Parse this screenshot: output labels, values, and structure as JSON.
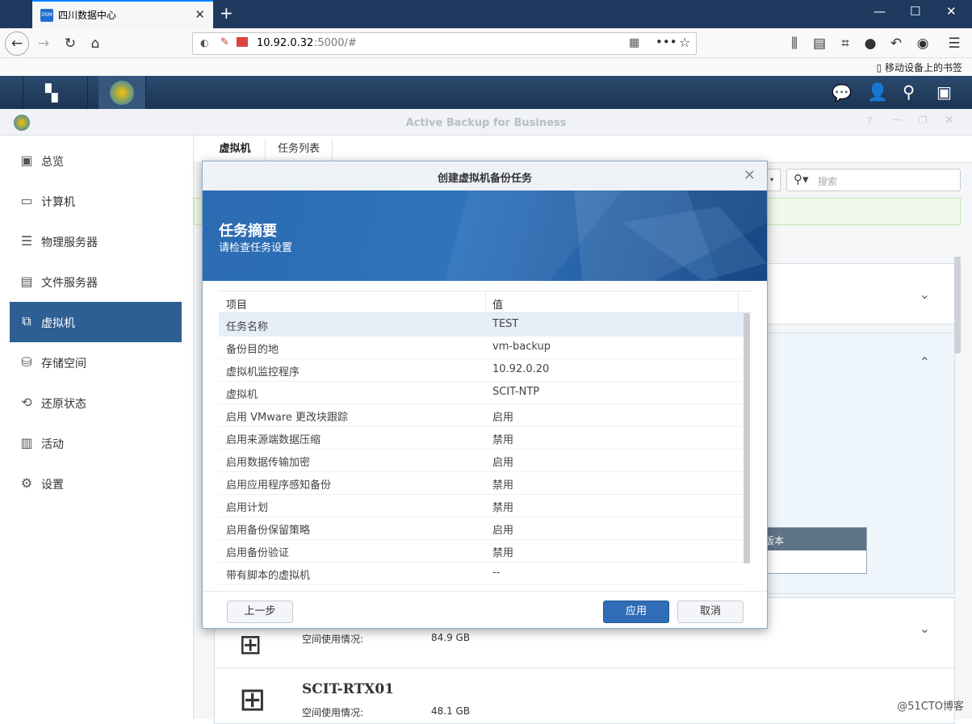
{
  "browser": {
    "tab_title": "四川数据中心",
    "tab_favicon": "DSM",
    "url_host": "10.92.0.32",
    "url_rest": ":5000/#",
    "bookmark_label": "移动设备上的书签"
  },
  "app": {
    "title": "Active Backup for Business"
  },
  "sidebar": {
    "items": [
      {
        "label": "总览",
        "icon": "overview-icon"
      },
      {
        "label": "计算机",
        "icon": "computer-icon"
      },
      {
        "label": "物理服务器",
        "icon": "server-icon"
      },
      {
        "label": "文件服务器",
        "icon": "file-server-icon"
      },
      {
        "label": "虚拟机",
        "icon": "vm-icon"
      },
      {
        "label": "存储空间",
        "icon": "storage-icon"
      },
      {
        "label": "还原状态",
        "icon": "restore-icon"
      },
      {
        "label": "活动",
        "icon": "activity-icon"
      },
      {
        "label": "设置",
        "icon": "gear-icon"
      }
    ],
    "active_index": 4
  },
  "content": {
    "tabs": [
      "虚拟机",
      "任务列表"
    ],
    "search_placeholder": "搜索",
    "peek_text": "版本",
    "cards": [
      {
        "name": "",
        "usage_label": "空间使用情况:",
        "usage_value": "84.9 GB"
      },
      {
        "name": "SCIT-RTX01",
        "usage_label": "空间使用情况:",
        "usage_value": "48.1 GB"
      }
    ]
  },
  "dialog": {
    "title": "创建虚拟机备份任务",
    "heading": "任务摘要",
    "subheading": "请检查任务设置",
    "columns": [
      "项目",
      "值"
    ],
    "rows": [
      [
        "任务名称",
        "TEST"
      ],
      [
        "备份目的地",
        "vm-backup"
      ],
      [
        "虚拟机监控程序",
        "10.92.0.20"
      ],
      [
        "虚拟机",
        "SCIT-NTP"
      ],
      [
        "启用 VMware 更改块跟踪",
        "启用"
      ],
      [
        "启用来源端数据压缩",
        "禁用"
      ],
      [
        "启用数据传输加密",
        "启用"
      ],
      [
        "启用应用程序感知备份",
        "禁用"
      ],
      [
        "启用计划",
        "禁用"
      ],
      [
        "启用备份保留策略",
        "启用"
      ],
      [
        "启用备份验证",
        "禁用"
      ],
      [
        "带有脚本的虚拟机",
        "--"
      ]
    ],
    "buttons": {
      "back": "上一步",
      "apply": "应用",
      "cancel": "取消"
    }
  },
  "watermark": "@51CTO博客"
}
